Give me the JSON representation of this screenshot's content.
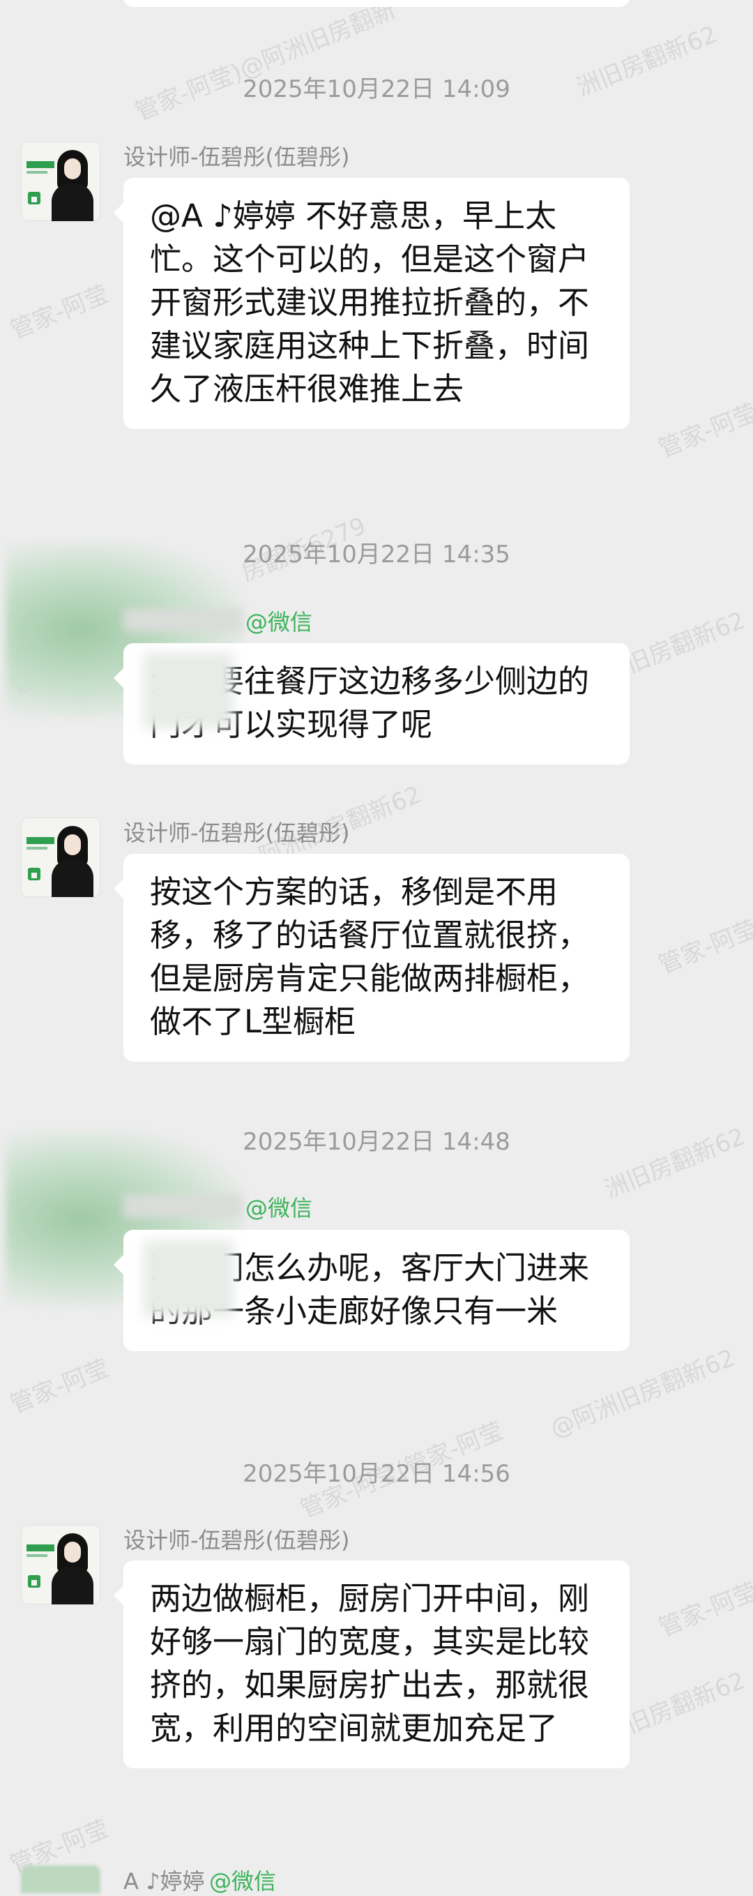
{
  "watermarks": [
    "管家-阿莹)@阿洲旧房翻新",
    "洲旧房翻新62",
    "管家-阿莹",
    "管家-阿莹",
    "房翻新6279",
    "管家-阿莹",
    "洲旧房翻新62",
    "-阿莹)@阿洲旧房翻新62",
    "管家-阿莹",
    "洲旧房翻新62",
    "管家-阿莹",
    "@阿洲旧房翻新62",
    "管家-阿莹(管家-阿莹",
    "管家-阿莹",
    "洲旧房翻新62",
    "管家-阿莹"
  ],
  "messages": [
    {
      "timestamp": "2025年10月22日  14:09",
      "sender": "设计师-伍碧彤(伍碧彤)",
      "text": "@A ♪婷婷 不好意思，早上太忙。这个可以的，但是这个窗户开窗形式建议用推拉折叠的，不建议家庭用这种上下折叠，时间久了液压杆很难推上去"
    },
    {
      "timestamp": "2025年10月22日  14:35",
      "sender_tag": "@微信",
      "text": "大概要往餐厅这边移多少侧边的门才可以实现得了呢"
    },
    {
      "sender": "设计师-伍碧彤(伍碧彤)",
      "text": "按这个方案的话，移倒是不用移，移了的话餐厅位置就很挤，但是厨房肯定只能做两排橱柜，做不了L型橱柜"
    },
    {
      "timestamp": "2025年10月22日  14:48",
      "sender_tag": "@微信",
      "text": "那厨门怎么办呢，客厅大门进来的那一条小走廊好像只有一米"
    },
    {
      "timestamp": "2025年10月22日  14:56",
      "sender": "设计师-伍碧彤(伍碧彤)",
      "text": "两边做橱柜，厨房门开中间，刚好够一扇门的宽度，其实是比较挤的，如果厨房扩出去，那就很宽，利用的空间就更加充足了"
    }
  ],
  "bottom_peek": {
    "sender": "A ♪婷婷",
    "sender_tag": "@微信"
  }
}
